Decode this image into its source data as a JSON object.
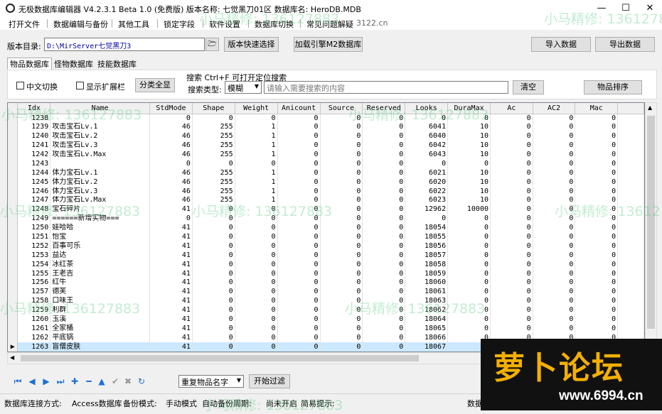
{
  "window": {
    "title": "无极数据库编辑器 V4.2.3.1    Beta 1.0 (免费版)        版本名称: 七觉黑刀01区        数据库名: HeroDB.MDB",
    "min": "—",
    "max": "☐",
    "close": "✕"
  },
  "menu": [
    "打开文件",
    "数据编辑与备份",
    "其他工具",
    "锁定字段",
    "软件设置",
    "数据库切换",
    "常见问题解疑",
    "3122.cn"
  ],
  "toolbar": {
    "dir_label": "版本目录:",
    "dir_value": "D:\\MirServer七觉黑刀3",
    "quick_select": "版本快速选择",
    "load_m2": "加载引擎M2数据库",
    "import": "导入数据",
    "export": "导出数据"
  },
  "tabs": [
    "物品数据库",
    "怪物数据库",
    "技能数据库"
  ],
  "filters": {
    "chinese_switch": "中文切换",
    "show_extension": "显示扩展栏",
    "category_all": "分类全显",
    "search_title": "搜索  Ctrl+F 可打开定位搜索",
    "search_type_label": "搜索类型:",
    "search_type_value": "模糊",
    "search_placeholder": "请输入需要搜索的内容",
    "clear": "清空",
    "sort": "物品排序"
  },
  "grid": {
    "columns": [
      "Idx",
      "Name",
      "StdMode",
      "Shape",
      "Weight",
      "Anicount",
      "Source",
      "Reserved",
      "Looks",
      "DuraMax",
      "Ac",
      "AC2",
      "Mac"
    ],
    "rows": [
      [
        "1238",
        "",
        "0",
        "0",
        "0",
        "0",
        "0",
        "0",
        "0",
        "0",
        "0",
        "0",
        "0"
      ],
      [
        "1239",
        "攻击宝石Lv.1",
        "46",
        "255",
        "1",
        "0",
        "0",
        "0",
        "6041",
        "10",
        "0",
        "0",
        "0"
      ],
      [
        "1240",
        "攻击宝石Lv.2",
        "46",
        "255",
        "1",
        "0",
        "0",
        "0",
        "6040",
        "10",
        "0",
        "0",
        "0"
      ],
      [
        "1241",
        "攻击宝石Lv.3",
        "46",
        "255",
        "1",
        "0",
        "0",
        "0",
        "6042",
        "10",
        "0",
        "0",
        "0"
      ],
      [
        "1242",
        "攻击宝石Lv.Max",
        "46",
        "255",
        "1",
        "0",
        "0",
        "0",
        "6043",
        "10",
        "0",
        "0",
        "0"
      ],
      [
        "1243",
        "",
        "0",
        "0",
        "0",
        "0",
        "0",
        "0",
        "0",
        "0",
        "0",
        "0",
        "0"
      ],
      [
        "1244",
        "体力宝石Lv.1",
        "46",
        "255",
        "1",
        "0",
        "0",
        "0",
        "6021",
        "10",
        "0",
        "0",
        "0"
      ],
      [
        "1245",
        "体力宝石Lv.2",
        "46",
        "255",
        "1",
        "0",
        "0",
        "0",
        "6020",
        "10",
        "0",
        "0",
        "0"
      ],
      [
        "1246",
        "体力宝石Lv.3",
        "46",
        "255",
        "1",
        "0",
        "0",
        "0",
        "6022",
        "10",
        "0",
        "0",
        "0"
      ],
      [
        "1247",
        "体力宝石Lv.Max",
        "46",
        "255",
        "1",
        "0",
        "0",
        "0",
        "6023",
        "10",
        "0",
        "0",
        "0"
      ],
      [
        "1248",
        "宝石碎片",
        "41",
        "0",
        "0",
        "0",
        "0",
        "0",
        "12962",
        "10000",
        "0",
        "0",
        "0"
      ],
      [
        "1249",
        "======新增实物===",
        "0",
        "0",
        "0",
        "0",
        "0",
        "0",
        "0",
        "0",
        "0",
        "0",
        "0"
      ],
      [
        "1250",
        "娃哈哈",
        "41",
        "0",
        "0",
        "0",
        "0",
        "0",
        "18054",
        "0",
        "0",
        "0",
        "0"
      ],
      [
        "1251",
        "怡宝",
        "41",
        "0",
        "0",
        "0",
        "0",
        "0",
        "18055",
        "0",
        "0",
        "0",
        "0"
      ],
      [
        "1252",
        "百事可乐",
        "41",
        "0",
        "0",
        "0",
        "0",
        "0",
        "18056",
        "0",
        "0",
        "0",
        "0"
      ],
      [
        "1253",
        "益达",
        "41",
        "0",
        "0",
        "0",
        "0",
        "0",
        "18057",
        "0",
        "0",
        "0",
        "0"
      ],
      [
        "1254",
        "冰红茶",
        "41",
        "0",
        "0",
        "0",
        "0",
        "0",
        "18058",
        "0",
        "0",
        "0",
        "0"
      ],
      [
        "1255",
        "王老吉",
        "41",
        "0",
        "0",
        "0",
        "0",
        "0",
        "18059",
        "0",
        "0",
        "0",
        "0"
      ],
      [
        "1256",
        "红牛",
        "41",
        "0",
        "0",
        "0",
        "0",
        "0",
        "18060",
        "0",
        "0",
        "0",
        "0"
      ],
      [
        "1257",
        "德芙",
        "41",
        "0",
        "0",
        "0",
        "0",
        "0",
        "18061",
        "0",
        "0",
        "0",
        "0"
      ],
      [
        "1258",
        "口味王",
        "41",
        "0",
        "0",
        "0",
        "0",
        "0",
        "18063",
        "0",
        "0",
        "0",
        "0"
      ],
      [
        "1259",
        "利群",
        "41",
        "0",
        "0",
        "0",
        "0",
        "0",
        "18062",
        "0",
        "0",
        "0",
        "0"
      ],
      [
        "1260",
        "玉溪",
        "41",
        "0",
        "0",
        "0",
        "0",
        "0",
        "18064",
        "0",
        "0",
        "0",
        "0"
      ],
      [
        "1261",
        "全家桶",
        "41",
        "0",
        "0",
        "0",
        "0",
        "0",
        "18065",
        "0",
        "0",
        "0",
        "0"
      ],
      [
        "1262",
        "平底锅",
        "41",
        "0",
        "0",
        "0",
        "0",
        "0",
        "18066",
        "0",
        "0",
        "0",
        "0"
      ],
      [
        "1263",
        "盲僧皮肤",
        "41",
        "0",
        "0",
        "0",
        "0",
        "0",
        "18067",
        "0",
        "0",
        "0",
        "0"
      ]
    ],
    "selected_row": 25
  },
  "bottom": {
    "dup_select": "重复物品名字",
    "start_filter": "开始过滤",
    "nav_icons": [
      "⏮",
      "◀",
      "▶",
      "⏭",
      "✚",
      "━",
      "▲",
      "✔",
      "✖",
      "↻"
    ]
  },
  "status": [
    "数据库连接方式:",
    "Access数据库",
    "备份模式:",
    "手动模式",
    "自动备份周期:",
    "尚未开启",
    "简易提示:",
    "数据"
  ],
  "watermark": "小马精修: 136127883",
  "logo": {
    "big": "萝卜论坛",
    "url": "www.6994.cn"
  },
  "colors": {
    "selected": "#cce8ff",
    "nav": "#1e6fd9",
    "logo_text": "#f4b000"
  }
}
